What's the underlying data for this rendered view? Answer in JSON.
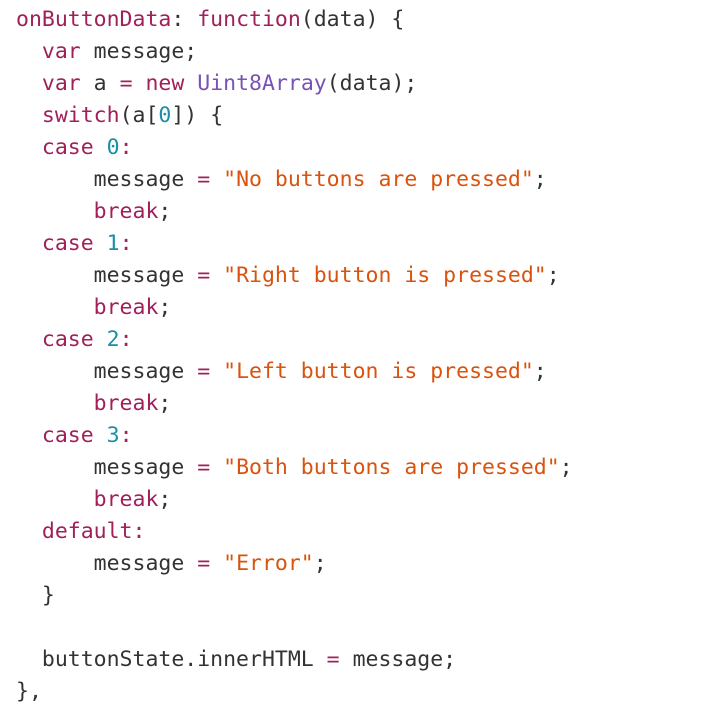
{
  "colors": {
    "plain": "#333333",
    "keyword": "#a0215a",
    "function": "#7952b3",
    "number": "#1a8fa6",
    "string": "#d9530e",
    "background": "#ffffff"
  },
  "code": {
    "lines": [
      {
        "tokens": [
          {
            "text": "onButtonData",
            "kind": "keyword"
          },
          {
            "text": ": ",
            "kind": "plain"
          },
          {
            "text": "function",
            "kind": "keyword"
          },
          {
            "text": "(data) {",
            "kind": "plain"
          }
        ]
      },
      {
        "tokens": [
          {
            "text": "  ",
            "kind": "plain"
          },
          {
            "text": "var",
            "kind": "keyword"
          },
          {
            "text": " message;",
            "kind": "plain"
          }
        ]
      },
      {
        "tokens": [
          {
            "text": "  ",
            "kind": "plain"
          },
          {
            "text": "var",
            "kind": "keyword"
          },
          {
            "text": " a ",
            "kind": "plain"
          },
          {
            "text": "=",
            "kind": "keyword"
          },
          {
            "text": " ",
            "kind": "plain"
          },
          {
            "text": "new",
            "kind": "keyword"
          },
          {
            "text": " ",
            "kind": "plain"
          },
          {
            "text": "Uint8Array",
            "kind": "function"
          },
          {
            "text": "(data);",
            "kind": "plain"
          }
        ]
      },
      {
        "tokens": [
          {
            "text": "  ",
            "kind": "plain"
          },
          {
            "text": "switch",
            "kind": "keyword"
          },
          {
            "text": "(a[",
            "kind": "plain"
          },
          {
            "text": "0",
            "kind": "number"
          },
          {
            "text": "]) {",
            "kind": "plain"
          }
        ]
      },
      {
        "tokens": [
          {
            "text": "  ",
            "kind": "plain"
          },
          {
            "text": "case",
            "kind": "keyword"
          },
          {
            "text": " ",
            "kind": "plain"
          },
          {
            "text": "0",
            "kind": "number"
          },
          {
            "text": ":",
            "kind": "keyword"
          }
        ]
      },
      {
        "tokens": [
          {
            "text": "      message ",
            "kind": "plain"
          },
          {
            "text": "=",
            "kind": "keyword"
          },
          {
            "text": " ",
            "kind": "plain"
          },
          {
            "text": "\"No buttons are pressed\"",
            "kind": "string"
          },
          {
            "text": ";",
            "kind": "plain"
          }
        ]
      },
      {
        "tokens": [
          {
            "text": "      ",
            "kind": "plain"
          },
          {
            "text": "break",
            "kind": "keyword"
          },
          {
            "text": ";",
            "kind": "plain"
          }
        ]
      },
      {
        "tokens": [
          {
            "text": "  ",
            "kind": "plain"
          },
          {
            "text": "case",
            "kind": "keyword"
          },
          {
            "text": " ",
            "kind": "plain"
          },
          {
            "text": "1",
            "kind": "number"
          },
          {
            "text": ":",
            "kind": "keyword"
          }
        ]
      },
      {
        "tokens": [
          {
            "text": "      message ",
            "kind": "plain"
          },
          {
            "text": "=",
            "kind": "keyword"
          },
          {
            "text": " ",
            "kind": "plain"
          },
          {
            "text": "\"Right button is pressed\"",
            "kind": "string"
          },
          {
            "text": ";",
            "kind": "plain"
          }
        ]
      },
      {
        "tokens": [
          {
            "text": "      ",
            "kind": "plain"
          },
          {
            "text": "break",
            "kind": "keyword"
          },
          {
            "text": ";",
            "kind": "plain"
          }
        ]
      },
      {
        "tokens": [
          {
            "text": "  ",
            "kind": "plain"
          },
          {
            "text": "case",
            "kind": "keyword"
          },
          {
            "text": " ",
            "kind": "plain"
          },
          {
            "text": "2",
            "kind": "number"
          },
          {
            "text": ":",
            "kind": "keyword"
          }
        ]
      },
      {
        "tokens": [
          {
            "text": "      message ",
            "kind": "plain"
          },
          {
            "text": "=",
            "kind": "keyword"
          },
          {
            "text": " ",
            "kind": "plain"
          },
          {
            "text": "\"Left button is pressed\"",
            "kind": "string"
          },
          {
            "text": ";",
            "kind": "plain"
          }
        ]
      },
      {
        "tokens": [
          {
            "text": "      ",
            "kind": "plain"
          },
          {
            "text": "break",
            "kind": "keyword"
          },
          {
            "text": ";",
            "kind": "plain"
          }
        ]
      },
      {
        "tokens": [
          {
            "text": "  ",
            "kind": "plain"
          },
          {
            "text": "case",
            "kind": "keyword"
          },
          {
            "text": " ",
            "kind": "plain"
          },
          {
            "text": "3",
            "kind": "number"
          },
          {
            "text": ":",
            "kind": "keyword"
          }
        ]
      },
      {
        "tokens": [
          {
            "text": "      message ",
            "kind": "plain"
          },
          {
            "text": "=",
            "kind": "keyword"
          },
          {
            "text": " ",
            "kind": "plain"
          },
          {
            "text": "\"Both buttons are pressed\"",
            "kind": "string"
          },
          {
            "text": ";",
            "kind": "plain"
          }
        ]
      },
      {
        "tokens": [
          {
            "text": "      ",
            "kind": "plain"
          },
          {
            "text": "break",
            "kind": "keyword"
          },
          {
            "text": ";",
            "kind": "plain"
          }
        ]
      },
      {
        "tokens": [
          {
            "text": "  ",
            "kind": "plain"
          },
          {
            "text": "default",
            "kind": "keyword"
          },
          {
            "text": ":",
            "kind": "keyword"
          }
        ]
      },
      {
        "tokens": [
          {
            "text": "      message ",
            "kind": "plain"
          },
          {
            "text": "=",
            "kind": "keyword"
          },
          {
            "text": " ",
            "kind": "plain"
          },
          {
            "text": "\"Error\"",
            "kind": "string"
          },
          {
            "text": ";",
            "kind": "plain"
          }
        ]
      },
      {
        "tokens": [
          {
            "text": "  }",
            "kind": "plain"
          }
        ]
      },
      {
        "tokens": [
          {
            "text": "",
            "kind": "plain"
          }
        ]
      },
      {
        "tokens": [
          {
            "text": "  buttonState.innerHTML ",
            "kind": "plain"
          },
          {
            "text": "=",
            "kind": "keyword"
          },
          {
            "text": " message;",
            "kind": "plain"
          }
        ]
      },
      {
        "tokens": [
          {
            "text": "},",
            "kind": "plain"
          }
        ]
      }
    ]
  }
}
